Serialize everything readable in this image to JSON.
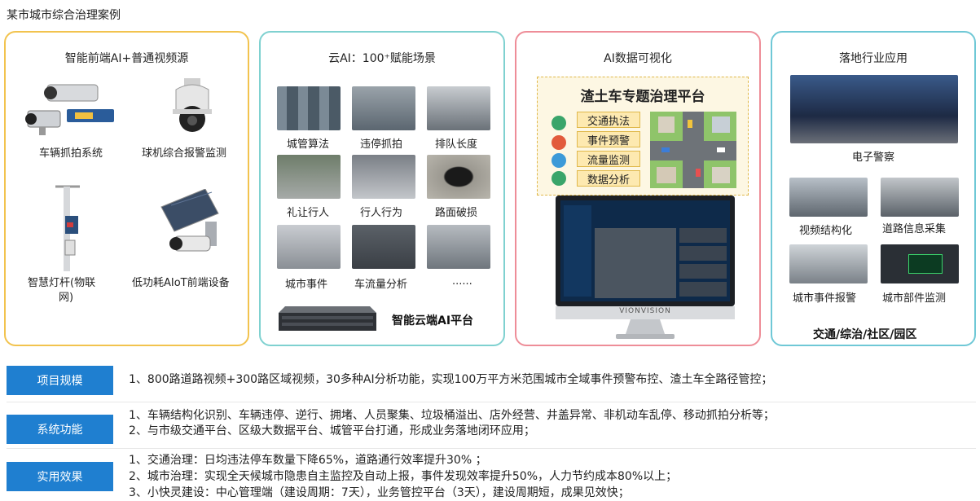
{
  "page_title": "某市城市综合治理案例",
  "panels": {
    "front": {
      "title": "智能前端AI+普通视频源",
      "devices": [
        {
          "label": "车辆抓拍系统",
          "icon": "camera-icon"
        },
        {
          "label": "球机综合报警监测",
          "icon": "dome-camera-icon"
        },
        {
          "label": "智慧灯杆(物联网)",
          "line1": "智慧灯杆(物联",
          "line2": "网)",
          "icon": "smart-pole-icon"
        },
        {
          "label": "低功耗AIoT前端设备",
          "icon": "solar-camera-icon"
        }
      ]
    },
    "cloud": {
      "title": "云AI：100⁺赋能场景",
      "scenes": [
        "城管算法",
        "违停抓拍",
        "排队长度",
        "礼让行人",
        "行人行为",
        "路面破损",
        "城市事件",
        "车流量分析",
        "......"
      ],
      "platform": "智能云端AI平台"
    },
    "viz": {
      "title": "AI数据可视化",
      "platform_title": "渣土车专题治理平台",
      "features": [
        "交通执法",
        "事件预警",
        "流量监测",
        "数据分析"
      ],
      "monitor_brand": "VIONVISION"
    },
    "apps": {
      "title": "落地行业应用",
      "items": [
        "电子警察",
        "视频结构化",
        "道路信息采集",
        "城市事件报警",
        "城市部件监测"
      ],
      "footer": "交通/综治/社区/园区"
    }
  },
  "rows": [
    {
      "label": "项目规模",
      "lines": [
        "1、800路道路视频+300路区域视频，30多种AI分析功能，实现100万平方米范围城市全域事件预警布控、渣土车全路径管控；"
      ]
    },
    {
      "label": "系统功能",
      "lines": [
        "1、车辆结构化识别、车辆违停、逆行、拥堵、人员聚集、垃圾桶溢出、店外经营、井盖异常、非机动车乱停、移动抓拍分析等；",
        "2、与市级交通平台、区级大数据平台、城管平台打通，形成业务落地闭环应用；"
      ]
    },
    {
      "label": "实用效果",
      "lines": [
        "1、交通治理：日均违法停车数量下降65%，道路通行效率提升30% ；",
        "2、城市治理：实现全天候城市隐患自主监控及自动上报，事件发现效率提升50%，人力节约成本80%以上；",
        "3、小快灵建设：中心管理端（建设周期：7天），业务管控平台（3天），建设周期短，成果见效快；"
      ]
    }
  ],
  "colors": {
    "panel1": "#f2c34e",
    "panel2": "#7fd1d0",
    "panel3": "#ee8d98",
    "panel4": "#6fc8d6",
    "label_bg": "#1f7fd0"
  }
}
